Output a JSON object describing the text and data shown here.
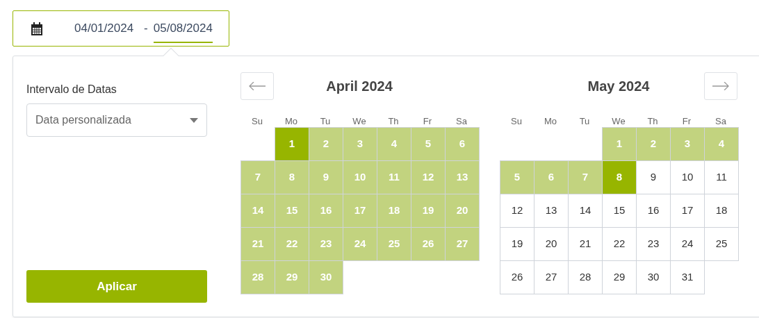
{
  "date_range_input": {
    "fields": [
      {
        "value": "04/01/2024",
        "selected": false
      },
      {
        "value": "05/08/2024",
        "selected": true
      }
    ],
    "separator": "-"
  },
  "panel": {
    "label": "Intervalo de Datas",
    "select": {
      "value": "Data personalizada"
    },
    "apply_button": "Aplicar"
  },
  "calendars": [
    {
      "title": "April 2024",
      "prev_button": true,
      "next_button": false,
      "weekdays": [
        "Su",
        "Mo",
        "Tu",
        "We",
        "Th",
        "Fr",
        "Sa"
      ],
      "days": [
        {
          "kind": "blank"
        },
        {
          "kind": "day",
          "label": "1",
          "selected": true
        },
        {
          "kind": "day",
          "label": "2",
          "selected": false,
          "in_range": true
        },
        {
          "kind": "day",
          "label": "3",
          "selected": false,
          "in_range": true
        },
        {
          "kind": "day",
          "label": "4",
          "selected": false,
          "in_range": true
        },
        {
          "kind": "day",
          "label": "5",
          "selected": false,
          "in_range": true
        },
        {
          "kind": "day",
          "label": "6",
          "selected": false,
          "in_range": true
        },
        {
          "kind": "day",
          "label": "7",
          "selected": false,
          "in_range": true
        },
        {
          "kind": "day",
          "label": "8",
          "selected": false,
          "in_range": true
        },
        {
          "kind": "day",
          "label": "9",
          "selected": false,
          "in_range": true
        },
        {
          "kind": "day",
          "label": "10",
          "selected": false,
          "in_range": true
        },
        {
          "kind": "day",
          "label": "11",
          "selected": false,
          "in_range": true
        },
        {
          "kind": "day",
          "label": "12",
          "selected": false,
          "in_range": true
        },
        {
          "kind": "day",
          "label": "13",
          "selected": false,
          "in_range": true
        },
        {
          "kind": "day",
          "label": "14",
          "selected": false,
          "in_range": true
        },
        {
          "kind": "day",
          "label": "15",
          "selected": false,
          "in_range": true
        },
        {
          "kind": "day",
          "label": "16",
          "selected": false,
          "in_range": true
        },
        {
          "kind": "day",
          "label": "17",
          "selected": false,
          "in_range": true
        },
        {
          "kind": "day",
          "label": "18",
          "selected": false,
          "in_range": true
        },
        {
          "kind": "day",
          "label": "19",
          "selected": false,
          "in_range": true
        },
        {
          "kind": "day",
          "label": "20",
          "selected": false,
          "in_range": true
        },
        {
          "kind": "day",
          "label": "21",
          "selected": false,
          "in_range": true
        },
        {
          "kind": "day",
          "label": "22",
          "selected": false,
          "in_range": true
        },
        {
          "kind": "day",
          "label": "23",
          "selected": false,
          "in_range": true
        },
        {
          "kind": "day",
          "label": "24",
          "selected": false,
          "in_range": true
        },
        {
          "kind": "day",
          "label": "25",
          "selected": false,
          "in_range": true
        },
        {
          "kind": "day",
          "label": "26",
          "selected": false,
          "in_range": true
        },
        {
          "kind": "day",
          "label": "27",
          "selected": false,
          "in_range": true
        },
        {
          "kind": "day",
          "label": "28",
          "selected": false,
          "in_range": true
        },
        {
          "kind": "day",
          "label": "29",
          "selected": false,
          "in_range": true
        },
        {
          "kind": "day",
          "label": "30",
          "selected": false,
          "in_range": true
        }
      ]
    },
    {
      "title": "May 2024",
      "prev_button": false,
      "next_button": true,
      "weekdays": [
        "Su",
        "Mo",
        "Tu",
        "We",
        "Th",
        "Fr",
        "Sa"
      ],
      "days": [
        {
          "kind": "blank"
        },
        {
          "kind": "blank"
        },
        {
          "kind": "blank"
        },
        {
          "kind": "day",
          "label": "1",
          "selected": false,
          "in_range": true
        },
        {
          "kind": "day",
          "label": "2",
          "selected": false,
          "in_range": true
        },
        {
          "kind": "day",
          "label": "3",
          "selected": false,
          "in_range": true
        },
        {
          "kind": "day",
          "label": "4",
          "selected": false,
          "in_range": true
        },
        {
          "kind": "day",
          "label": "5",
          "selected": false,
          "in_range": true
        },
        {
          "kind": "day",
          "label": "6",
          "selected": false,
          "in_range": true
        },
        {
          "kind": "day",
          "label": "7",
          "selected": false,
          "in_range": true
        },
        {
          "kind": "day",
          "label": "8",
          "selected": true
        },
        {
          "kind": "day",
          "label": "9",
          "selected": false,
          "in_range": false
        },
        {
          "kind": "day",
          "label": "10",
          "selected": false,
          "in_range": false
        },
        {
          "kind": "day",
          "label": "11",
          "selected": false,
          "in_range": false
        },
        {
          "kind": "day",
          "label": "12",
          "selected": false,
          "in_range": false
        },
        {
          "kind": "day",
          "label": "13",
          "selected": false,
          "in_range": false
        },
        {
          "kind": "day",
          "label": "14",
          "selected": false,
          "in_range": false
        },
        {
          "kind": "day",
          "label": "15",
          "selected": false,
          "in_range": false
        },
        {
          "kind": "day",
          "label": "16",
          "selected": false,
          "in_range": false
        },
        {
          "kind": "day",
          "label": "17",
          "selected": false,
          "in_range": false
        },
        {
          "kind": "day",
          "label": "18",
          "selected": false,
          "in_range": false
        },
        {
          "kind": "day",
          "label": "19",
          "selected": false,
          "in_range": false
        },
        {
          "kind": "day",
          "label": "20",
          "selected": false,
          "in_range": false
        },
        {
          "kind": "day",
          "label": "21",
          "selected": false,
          "in_range": false
        },
        {
          "kind": "day",
          "label": "22",
          "selected": false,
          "in_range": false
        },
        {
          "kind": "day",
          "label": "23",
          "selected": false,
          "in_range": false
        },
        {
          "kind": "day",
          "label": "24",
          "selected": false,
          "in_range": false
        },
        {
          "kind": "day",
          "label": "25",
          "selected": false,
          "in_range": false
        },
        {
          "kind": "day",
          "label": "26",
          "selected": false,
          "in_range": false
        },
        {
          "kind": "day",
          "label": "27",
          "selected": false,
          "in_range": false
        },
        {
          "kind": "day",
          "label": "28",
          "selected": false,
          "in_range": false
        },
        {
          "kind": "day",
          "label": "29",
          "selected": false,
          "in_range": false
        },
        {
          "kind": "day",
          "label": "30",
          "selected": false,
          "in_range": false
        },
        {
          "kind": "day",
          "label": "31",
          "selected": false,
          "in_range": false
        }
      ]
    }
  ]
}
